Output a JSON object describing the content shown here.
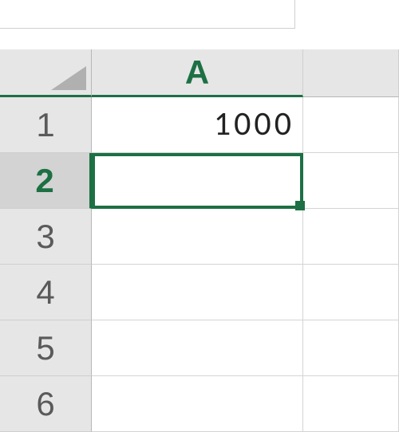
{
  "columns": {
    "A": "A"
  },
  "rows": [
    "1",
    "2",
    "3",
    "4",
    "5",
    "6"
  ],
  "cells": {
    "A1": "1000",
    "A2": ""
  },
  "active_cell": "A2",
  "colors": {
    "accent": "#1d7044",
    "header_bg": "#e6e6e6",
    "grid_line": "#d4d4d4"
  }
}
